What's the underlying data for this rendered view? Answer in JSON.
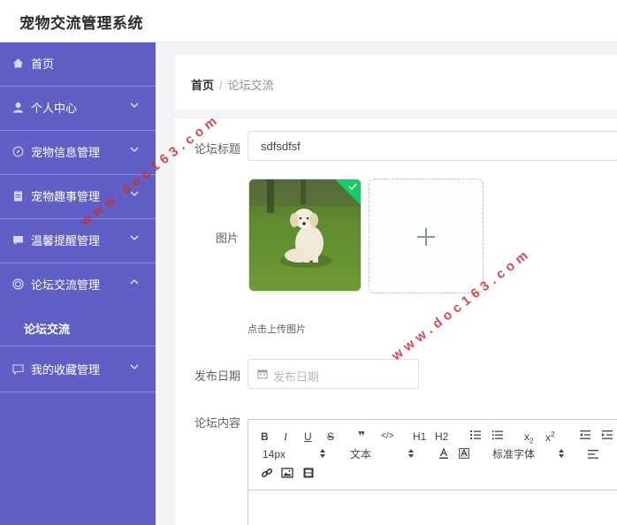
{
  "app": {
    "title": "宠物交流管理系统"
  },
  "sidebar": {
    "items": [
      {
        "label": "首页",
        "icon": "home-icon",
        "has_arrow": false
      },
      {
        "label": "个人中心",
        "icon": "user-icon",
        "has_arrow": true
      },
      {
        "label": "宠物信息管理",
        "icon": "compass-icon",
        "has_arrow": true
      },
      {
        "label": "宠物趣事管理",
        "icon": "clipboard-icon",
        "has_arrow": true
      },
      {
        "label": "温馨提醒管理",
        "icon": "comment-icon",
        "has_arrow": true
      },
      {
        "label": "论坛交流管理",
        "icon": "target-icon",
        "has_arrow": true,
        "expanded": true
      },
      {
        "label": "我的收藏管理",
        "icon": "message-icon",
        "has_arrow": true
      }
    ],
    "subitem": {
      "label": "论坛交流"
    }
  },
  "breadcrumb": {
    "home": "首页",
    "separator": "/",
    "current": "论坛交流"
  },
  "form": {
    "title_label": "论坛标题",
    "title_value": "sdfsdfsf",
    "image_label": "图片",
    "upload_tip": "点击上传图片",
    "date_label": "发布日期",
    "date_placeholder": "发布日期",
    "content_label": "论坛内容"
  },
  "editor": {
    "buttons": [
      "B",
      "I",
      "U",
      "S",
      "❞",
      "</>",
      "H1",
      "H2",
      "x2-sub",
      "x2-sup"
    ],
    "font_size": "14px",
    "text_type": "文本",
    "font_family": "标准字体"
  },
  "watermarks": [
    "www.doc163.com",
    "www.doc163.com"
  ],
  "colors": {
    "sidebar": "#5f5fc5",
    "accent_success": "#13ce66",
    "watermark": "#d42b2b"
  }
}
